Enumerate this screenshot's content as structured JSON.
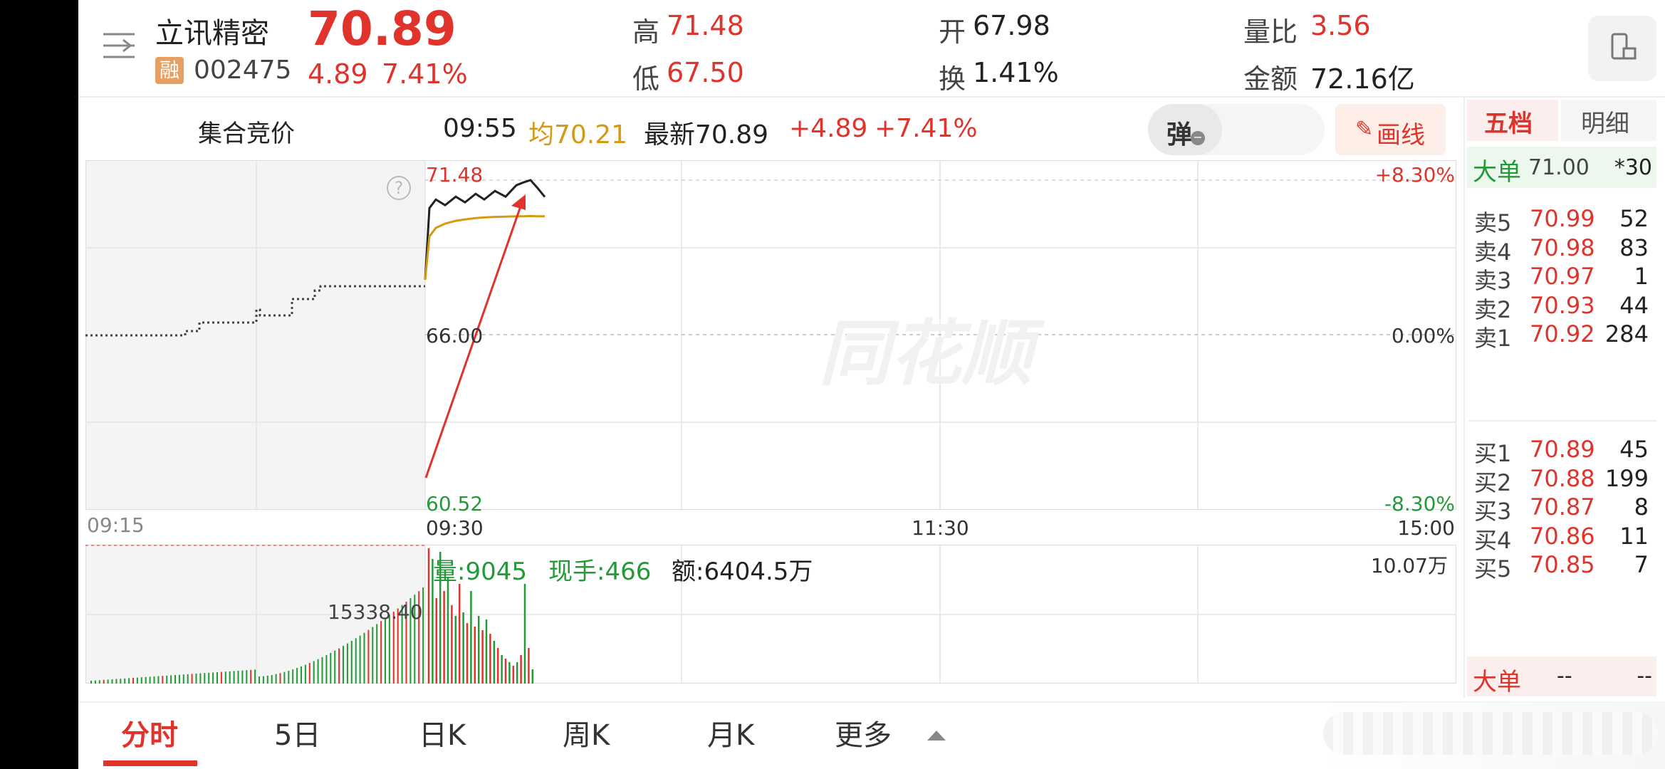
{
  "header": {
    "name": "立讯精密",
    "code": "002475",
    "margin_badge": "融",
    "price": "70.89",
    "change": "4.89",
    "change_pct": "7.41%",
    "high_label": "高",
    "high": "71.48",
    "low_label": "低",
    "low": "67.50",
    "open_label": "开",
    "open": "67.98",
    "turnover_label": "换",
    "turnover": "1.41%",
    "vol_ratio_label": "量比",
    "vol_ratio": "3.56",
    "amount_label": "金额",
    "amount": "72.16亿"
  },
  "infobar": {
    "auction_label": "集合竞价",
    "time": "09:55",
    "avg": "均70.21",
    "latest": "最新70.89",
    "chg": "+4.89",
    "chg_pct": "+7.41%",
    "danmu_button": "弹",
    "draw_button": "画线"
  },
  "chart": {
    "price_high": "71.48",
    "price_mid": "66.00",
    "price_low": "60.52",
    "pct_high": "+8.30%",
    "pct_mid": "0.00%",
    "pct_low": "-8.30%",
    "time_auction": "09:15",
    "time_open": "09:30",
    "time_noon": "11:30",
    "time_close": "15:00",
    "watermark": "同花顺",
    "auction_vol_label": "15338.40",
    "vol_label": "量:9045",
    "current_hand_label": "现手:466",
    "amount_label": "额:6404.5万",
    "vol_axis_max": "10.07万",
    "colors": {
      "price_line": "#222222",
      "avg_line": "#d49a16",
      "up": "#e0332c",
      "down": "#239a38"
    }
  },
  "chart_data": {
    "type": "line",
    "x_axis": [
      "09:30",
      "11:30",
      "15:00"
    ],
    "ylim": [
      60.52,
      71.48
    ],
    "series": [
      {
        "values": [
          67.98,
          70.5,
          70.8,
          70.6,
          70.9,
          70.7,
          71.0,
          70.8,
          71.1,
          70.9,
          71.3,
          71.4,
          71.48,
          71.2,
          70.89
        ]
      },
      {
        "values": [
          67.98,
          69.5,
          69.8,
          69.95,
          70.05,
          70.1,
          70.15,
          70.17,
          70.19,
          70.2,
          70.21,
          70.21,
          70.22,
          70.21,
          70.21
        ]
      }
    ]
  },
  "orderbook": {
    "tab_five": "五档",
    "tab_detail": "明细",
    "big_order_label": "大单",
    "big_order_price": "71.00",
    "big_order_vol": "*30",
    "asks": [
      {
        "label": "卖5",
        "price": "70.99",
        "vol": "52"
      },
      {
        "label": "卖4",
        "price": "70.98",
        "vol": "83"
      },
      {
        "label": "卖3",
        "price": "70.97",
        "vol": "1"
      },
      {
        "label": "卖2",
        "price": "70.93",
        "vol": "44"
      },
      {
        "label": "卖1",
        "price": "70.92",
        "vol": "284"
      }
    ],
    "bids": [
      {
        "label": "买1",
        "price": "70.89",
        "vol": "45"
      },
      {
        "label": "买2",
        "price": "70.88",
        "vol": "199"
      },
      {
        "label": "买3",
        "price": "70.87",
        "vol": "8"
      },
      {
        "label": "买4",
        "price": "70.86",
        "vol": "11"
      },
      {
        "label": "买5",
        "price": "70.85",
        "vol": "7"
      }
    ],
    "bottom_big_label": "大单",
    "bottom_big_price": "--",
    "bottom_big_vol": "--"
  },
  "tabs": [
    "分时",
    "5日",
    "日K",
    "周K",
    "月K",
    "更多"
  ]
}
